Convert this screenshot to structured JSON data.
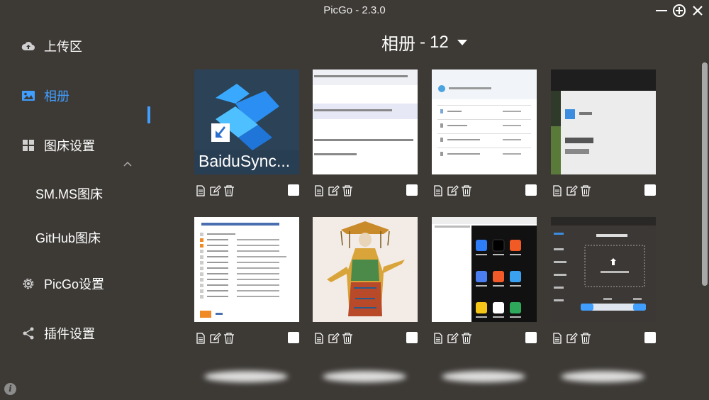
{
  "window": {
    "title": "PicGo - 2.3.0"
  },
  "sidebar": {
    "items": [
      {
        "label": "上传区",
        "icon": "cloud-upload-icon"
      },
      {
        "label": "相册",
        "icon": "image-icon"
      },
      {
        "label": "图床设置",
        "icon": "grid-icon"
      },
      {
        "label": "SM.MS图床"
      },
      {
        "label": "GitHub图床"
      },
      {
        "label": "PicGo设置",
        "icon": "gear-icon"
      },
      {
        "label": "插件设置",
        "icon": "share-icon"
      }
    ],
    "active_index": 1,
    "info_glyph": "i"
  },
  "gallery": {
    "title": "相册",
    "separator": "-",
    "count": "12",
    "items": [
      {
        "thumb": "baidusync-shortcut",
        "thumb_text": "BaiduSync...",
        "checked": false
      },
      {
        "thumb": "url-list",
        "thumb_text": "",
        "checked": false
      },
      {
        "thumb": "github-file-list",
        "thumb_text": "",
        "checked": false
      },
      {
        "thumb": "picgo-settings-result",
        "thumb_text": "",
        "checked": false
      },
      {
        "thumb": "scope-permissions-list",
        "thumb_text": "",
        "checked": false
      },
      {
        "thumb": "costume-figure",
        "thumb_text": "",
        "checked": false
      },
      {
        "thumb": "phone-app-grid",
        "thumb_text": "",
        "checked": false
      },
      {
        "thumb": "picgo-upload-screen",
        "thumb_text": "",
        "checked": false
      }
    ]
  },
  "colors": {
    "background": "#3d3a36",
    "accent": "#409eff",
    "text": "#ffffff"
  }
}
